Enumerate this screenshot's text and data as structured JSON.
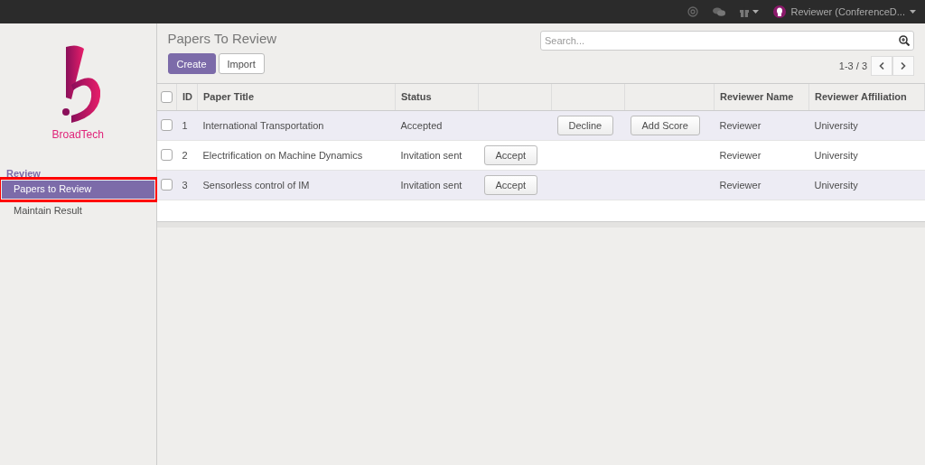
{
  "topbar": {
    "user": "Reviewer (ConferenceD..."
  },
  "sidebar": {
    "logo_text": "BroadTech",
    "section": "Review",
    "items": [
      {
        "label": "Papers to Review",
        "selected": true,
        "highlighted": true
      },
      {
        "label": "Maintain Result",
        "selected": false,
        "highlighted": false
      }
    ]
  },
  "title": "Papers To Review",
  "buttons": {
    "create": "Create",
    "import": "Import"
  },
  "search": {
    "placeholder": "Search..."
  },
  "pager": "1-3 / 3",
  "table": {
    "select_all_checked": false,
    "columns": [
      "ID",
      "Paper Title",
      "Status",
      null,
      null,
      null,
      "Reviewer Name",
      "Reviewer Affiliation"
    ],
    "rows": [
      {
        "checked": false,
        "id": "1",
        "title": "International Transportation",
        "status": "Accepted",
        "decline": "Decline",
        "add_score": "Add Score",
        "reviewer": "Reviewer",
        "affiliation": "University"
      },
      {
        "checked": false,
        "id": "2",
        "title": "Electrification on Machine Dynamics",
        "status": "Invitation sent",
        "accept": "Accept",
        "reviewer": "Reviewer",
        "affiliation": "University"
      },
      {
        "checked": false,
        "id": "3",
        "title": "Sensorless control of IM",
        "status": "Invitation sent",
        "accept": "Accept",
        "reviewer": "Reviewer",
        "affiliation": "University"
      }
    ]
  }
}
